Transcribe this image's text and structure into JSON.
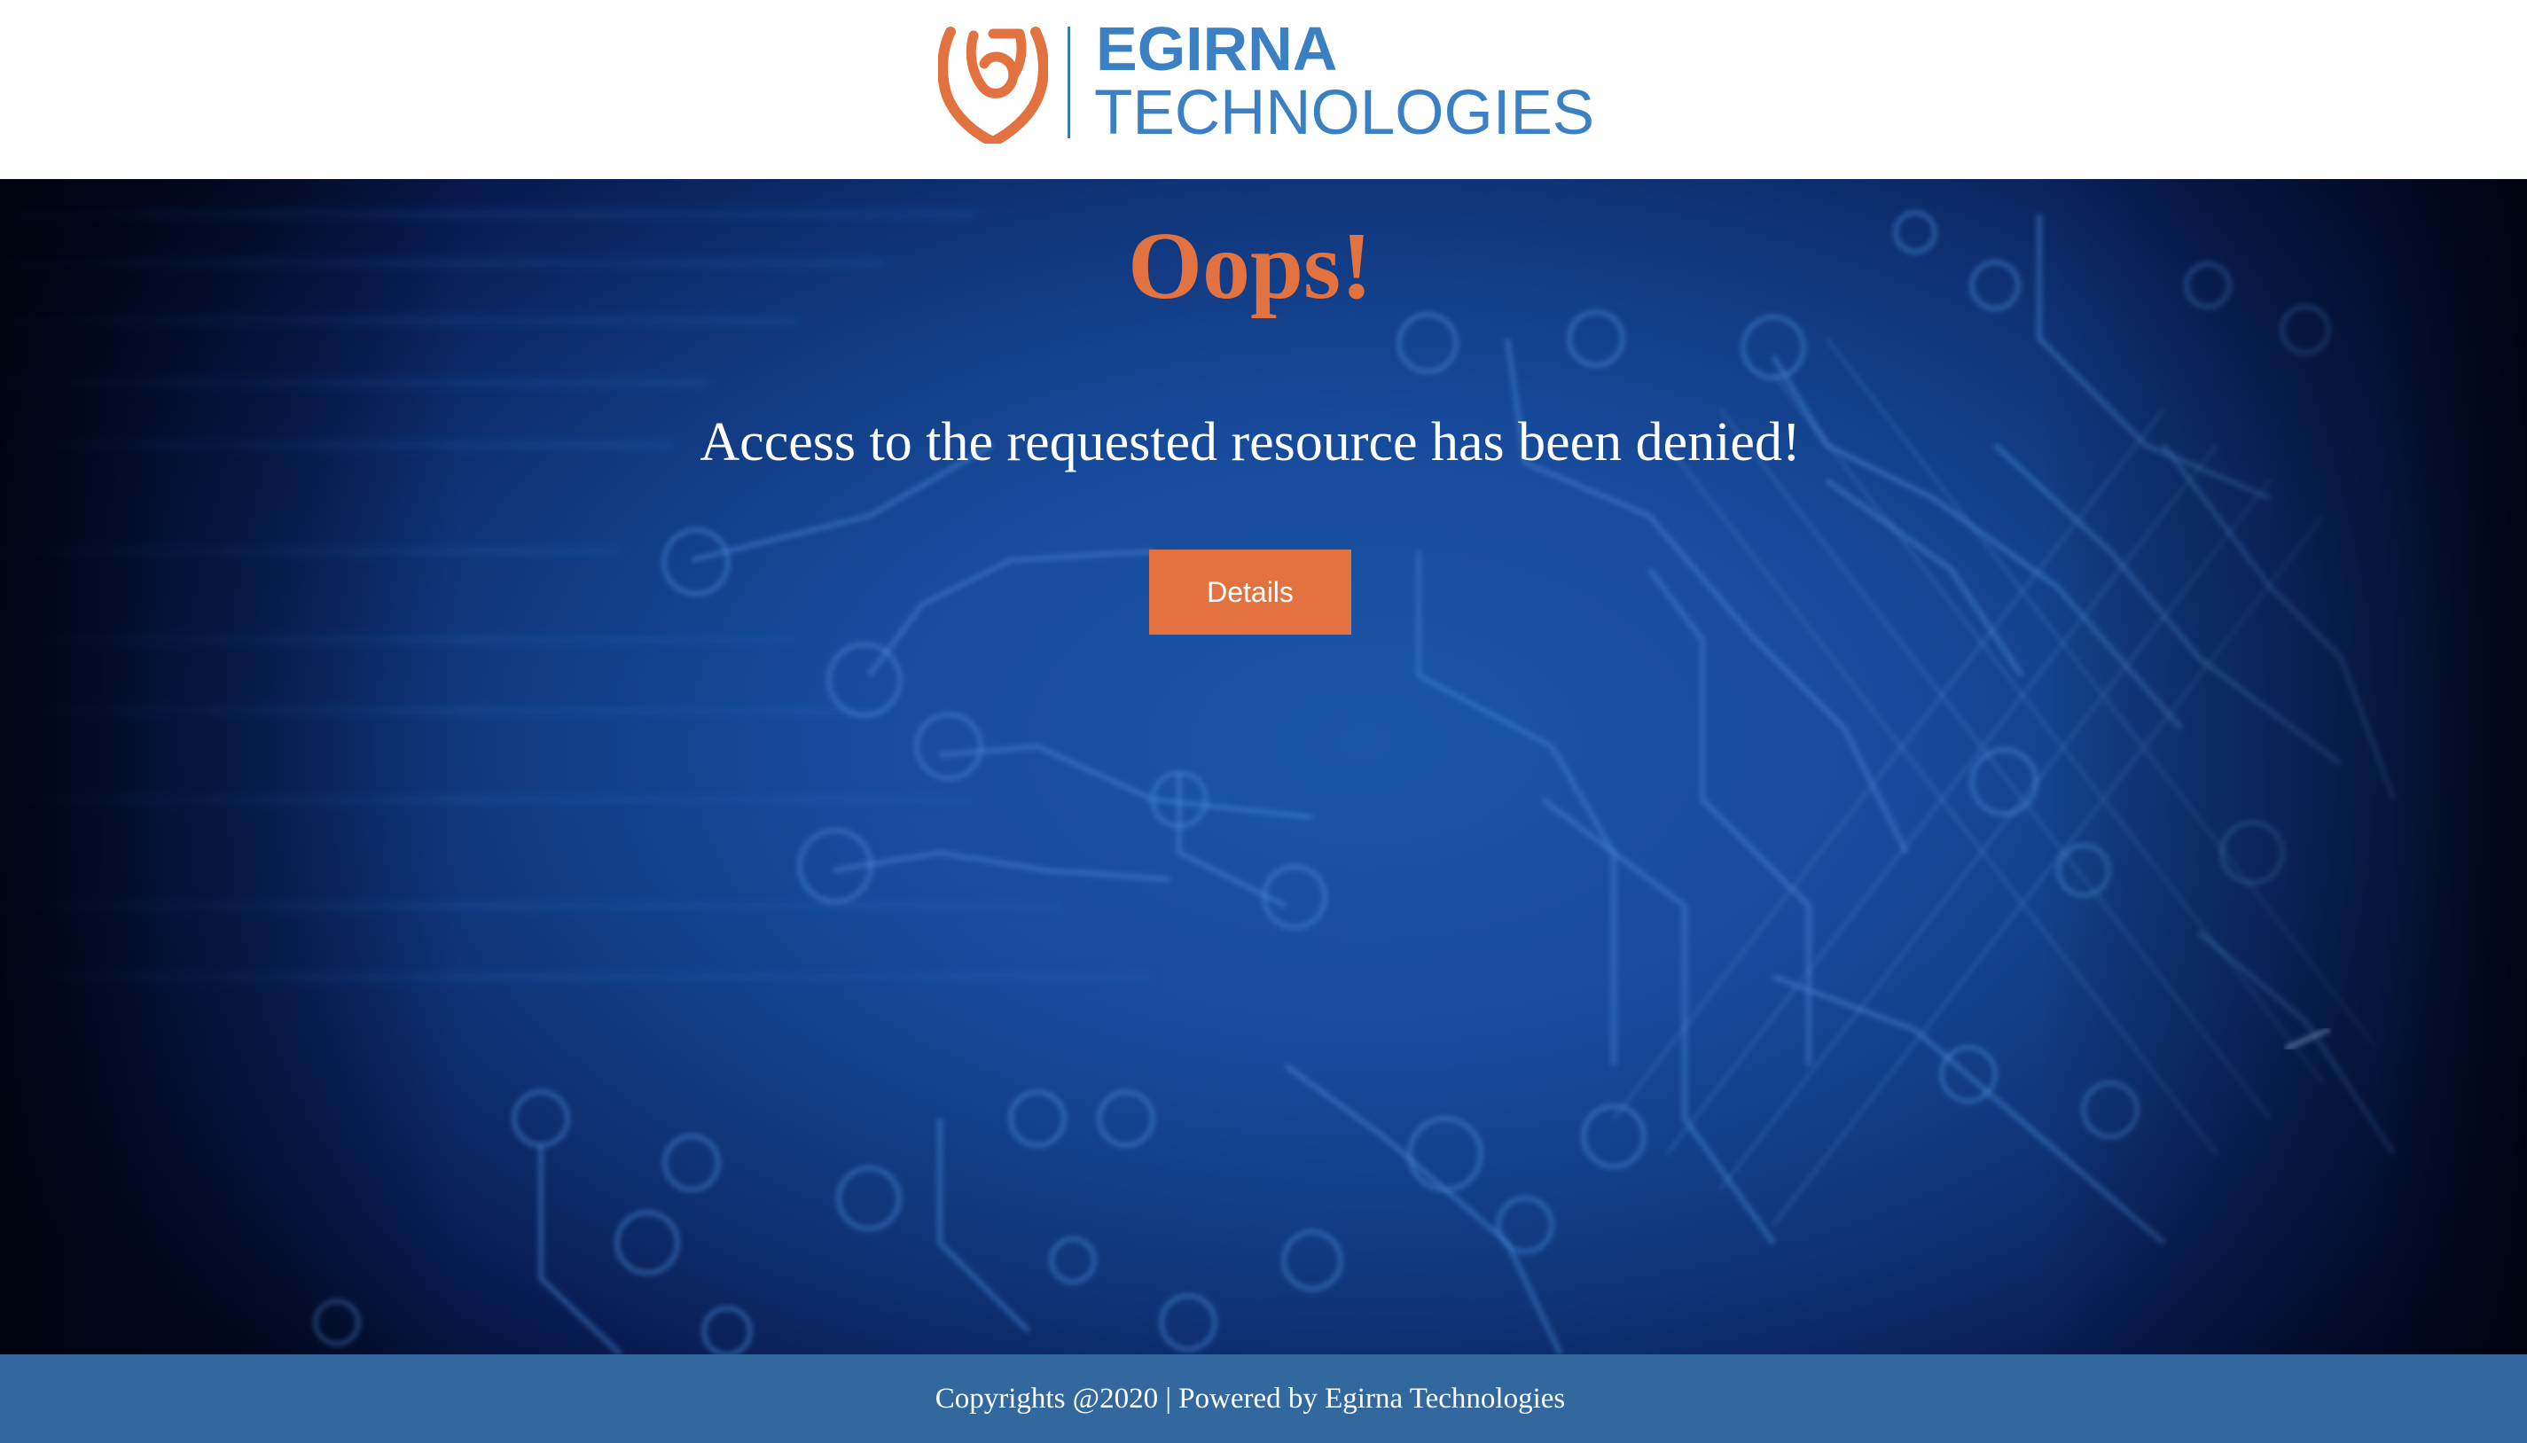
{
  "header": {
    "logo": {
      "icon": "shield-logo-icon",
      "name_top": "EGIRNA",
      "name_bottom": "TECHNOLOGIES",
      "mark_color": "#e2723f",
      "text_color": "#3a80c3"
    }
  },
  "main": {
    "title": "Oops!",
    "message": "Access to the requested resource has been denied!",
    "details_button_label": "Details",
    "accent_color": "#e2723f",
    "background": "circuit-board-blue"
  },
  "footer": {
    "text": "Copyrights @2020 | Powered by Egirna Technologies",
    "background_color": "#33689f"
  }
}
